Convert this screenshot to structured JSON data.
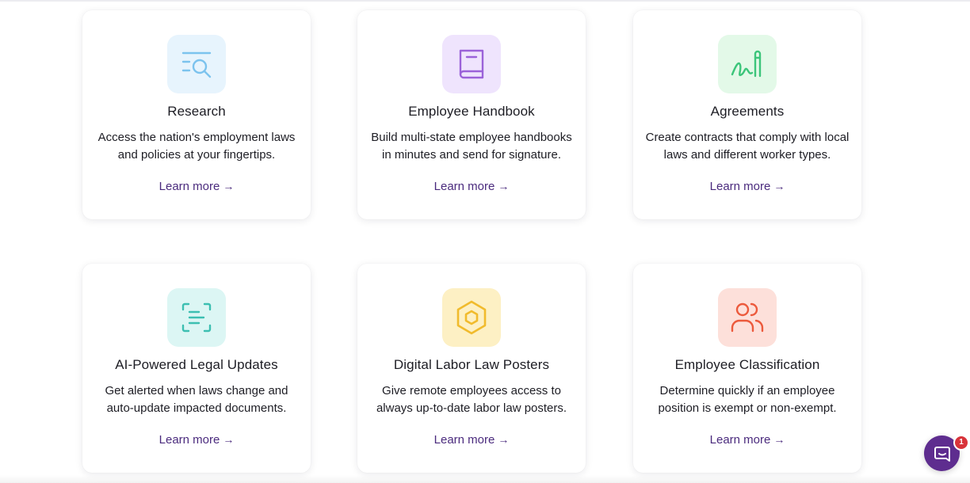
{
  "cards": [
    {
      "title": "Research",
      "description_line1": "Access the nation's employment laws",
      "description_line2": "and policies at your fingertips.",
      "link": "Learn more",
      "arrow": "→",
      "icon": "research-magnifier-icon",
      "tile_color": "#e7f4fd",
      "icon_color": "#7cc3ee"
    },
    {
      "title": "Employee Handbook",
      "description_line1": "Build multi-state employee handbooks",
      "description_line2": "in minutes and send for signature.",
      "link": "Learn more",
      "arrow": "→",
      "icon": "book-icon",
      "tile_color": "#efe4fd",
      "icon_color": "#9b62d9"
    },
    {
      "title": "Agreements",
      "description_line1": "Create contracts that comply with local",
      "description_line2": "laws and different worker types.",
      "link": "Learn more",
      "arrow": "→",
      "icon": "signature-pen-icon",
      "tile_color": "#e3f9e8",
      "icon_color": "#3cc57a"
    },
    {
      "title": "AI-Powered Legal Updates",
      "description_line1": "Get alerted when laws change and",
      "description_line2": "auto-update impacted documents.",
      "link": "Learn more",
      "arrow": "→",
      "icon": "document-scan-icon",
      "tile_color": "#dcf6f4",
      "icon_color": "#3cbfb1"
    },
    {
      "title": "Digital Labor Law Posters",
      "description_line1": "Give remote employees access to",
      "description_line2": "always up-to-date labor law posters.",
      "link": "Learn more",
      "arrow": "→",
      "icon": "hexagon-icon",
      "tile_color": "#fdf0c4",
      "icon_color": "#f1bb2d"
    },
    {
      "title": "Employee Classification",
      "description_line1": "Determine quickly if an employee",
      "description_line2": "position is exempt or non-exempt.",
      "link": "Learn more",
      "arrow": "→",
      "icon": "users-icon",
      "tile_color": "#fde0da",
      "icon_color": "#ec5a3c"
    }
  ],
  "chat": {
    "icon": "chat-bubble-icon",
    "badge_count": "1",
    "button_color": "#5e2d8f",
    "badge_color": "#d8333a"
  }
}
